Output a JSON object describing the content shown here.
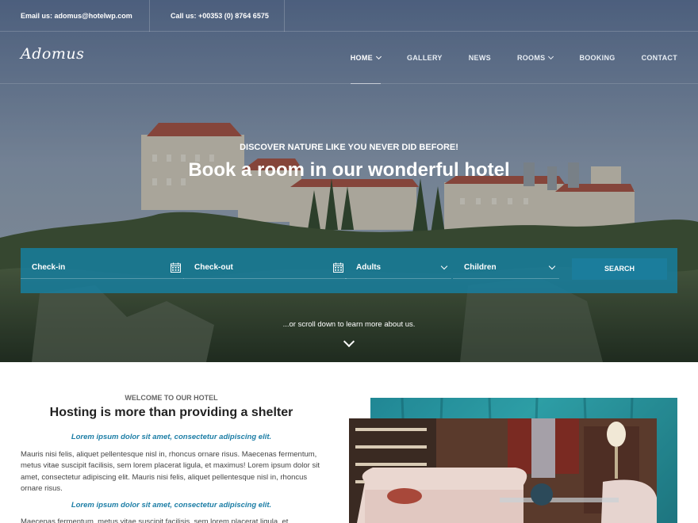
{
  "topbar": {
    "email": "Email us: adomus@hotelwp.com",
    "phone": "Call us: +00353 (0) 8764 6575"
  },
  "header": {
    "logo": "Adomus",
    "nav": [
      {
        "label": "HOME",
        "active": true,
        "has_dropdown": true
      },
      {
        "label": "GALLERY",
        "active": false,
        "has_dropdown": false
      },
      {
        "label": "NEWS",
        "active": false,
        "has_dropdown": false
      },
      {
        "label": "ROOMS",
        "active": false,
        "has_dropdown": true
      },
      {
        "label": "BOOKING",
        "active": false,
        "has_dropdown": false
      },
      {
        "label": "CONTACT",
        "active": false,
        "has_dropdown": false
      }
    ]
  },
  "hero": {
    "kicker": "DISCOVER NATURE LIKE YOU NEVER DID BEFORE!",
    "headline": "Book a room in our wonderful hotel",
    "scroll_note": "...or scroll down to learn more about us."
  },
  "booking": {
    "checkin_placeholder": "Check-in",
    "checkout_placeholder": "Check-out",
    "adults_label": "Adults",
    "children_label": "Children",
    "search_label": "SEARCH",
    "icons": {
      "calendar": "calendar-icon",
      "dropdown": "chevron-down-icon"
    }
  },
  "welcome": {
    "kicker": "WELCOME TO OUR HOTEL",
    "title": "Hosting is more than providing a shelter",
    "lead": "Lorem ipsum dolor sit amet, consectetur adipiscing elit.",
    "body": "Mauris nisi felis, aliquet pellentesque nisl in, rhoncus ornare risus. Maecenas fermentum, metus vitae suscipit facilisis, sem lorem placerat ligula, et maximus! Lorem ipsum dolor sit amet, consectetur adipiscing elit. Mauris nisi felis, aliquet pellentesque nisl in, rhoncus ornare risus.",
    "lead2": "Lorem ipsum dolor sit amet, consectetur adipiscing elit.",
    "body2": "Maecenas fermentum, metus vitae suscipit facilisis, sem lorem placerat ligula, et"
  },
  "colors": {
    "accent": "#1d7ea6",
    "booking_bar": "#1680a2",
    "search_button": "#1b7d9c",
    "teal_block": "#2b9aa3"
  }
}
